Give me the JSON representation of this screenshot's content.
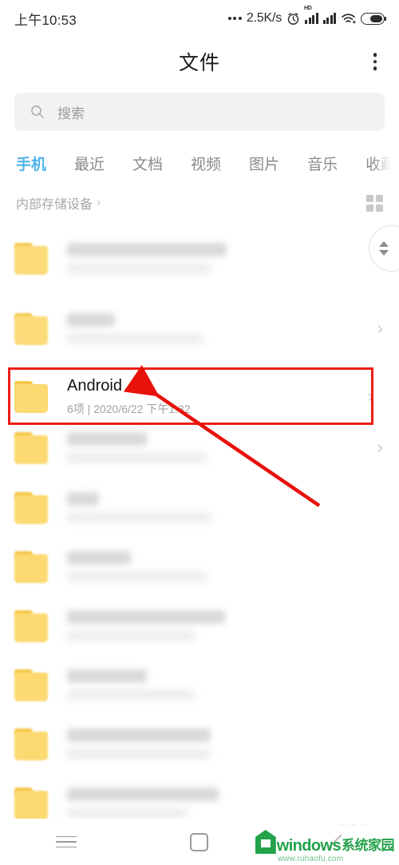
{
  "status_bar": {
    "time": "上午10:53",
    "net_speed": "2.5K/s",
    "hd_label": "HD",
    "icons": [
      "three-dots",
      "alarm-clock",
      "signal-hd",
      "signal",
      "wifi",
      "battery"
    ]
  },
  "header": {
    "title": "文件",
    "menu_icon": "kebab-menu-icon"
  },
  "search": {
    "placeholder": "搜索",
    "icon": "search-icon"
  },
  "tabs": [
    {
      "label": "手机",
      "active": true
    },
    {
      "label": "最近",
      "active": false
    },
    {
      "label": "文档",
      "active": false
    },
    {
      "label": "视频",
      "active": false
    },
    {
      "label": "图片",
      "active": false
    },
    {
      "label": "音乐",
      "active": false
    },
    {
      "label": "收藏",
      "active": false
    }
  ],
  "breadcrumb": {
    "label": "内部存储设备",
    "chevron": "›",
    "grid_view_icon": "grid-view-icon"
  },
  "file_list": [
    {
      "name": "",
      "meta": "",
      "redacted": true,
      "name_w": 200,
      "meta_w": 180,
      "chevron": "›"
    },
    {
      "name": "",
      "meta": "",
      "redacted": true,
      "name_w": 60,
      "meta_w": 170,
      "chevron": "›"
    },
    {
      "name": "Android",
      "meta": "6项 | 2020/6/22 下午1:32",
      "redacted": false,
      "name_w": 0,
      "meta_w": 0,
      "chevron": "›",
      "highlighted": true
    },
    {
      "name": "",
      "meta": "",
      "redacted": true,
      "name_w": 100,
      "meta_w": 175,
      "chevron": "›"
    },
    {
      "name": "",
      "meta": "",
      "redacted": true,
      "name_w": 40,
      "meta_w": 180,
      "chevron": ""
    },
    {
      "name": "",
      "meta": "",
      "redacted": true,
      "name_w": 80,
      "meta_w": 175,
      "chevron": ""
    },
    {
      "name": "",
      "meta": "",
      "redacted": true,
      "name_w": 198,
      "meta_w": 160,
      "chevron": ""
    },
    {
      "name": "",
      "meta": "",
      "redacted": true,
      "name_w": 100,
      "meta_w": 160,
      "chevron": ""
    },
    {
      "name": "",
      "meta": "",
      "redacted": true,
      "name_w": 180,
      "meta_w": 180,
      "chevron": ""
    },
    {
      "name": "",
      "meta": "",
      "redacted": true,
      "name_w": 190,
      "meta_w": 150,
      "chevron": ""
    }
  ],
  "annotation": {
    "box_color": "#ee1c16",
    "arrow_color": "#e8110b",
    "target_row_name": "Android"
  },
  "scroll_indicator": {
    "up_icon": "triangle-up-icon",
    "down_icon": "triangle-down-icon"
  },
  "nav_bar": {
    "recents_icon": "hamburger-icon",
    "home_icon": "square-home-icon",
    "back_icon": "back-slash-icon"
  },
  "watermark": {
    "brand_en": "windows",
    "brand_cn": "系统家园",
    "url": "www.ruhaofu.com"
  },
  "colors": {
    "accent": "#4fb4ea",
    "folder": "#fcd971",
    "folder_lip": "#f6c74a",
    "annotation_red": "#ee1c16",
    "watermark_green": "#22a24a",
    "text_primary": "#141414",
    "text_secondary": "#a2a2a2"
  }
}
